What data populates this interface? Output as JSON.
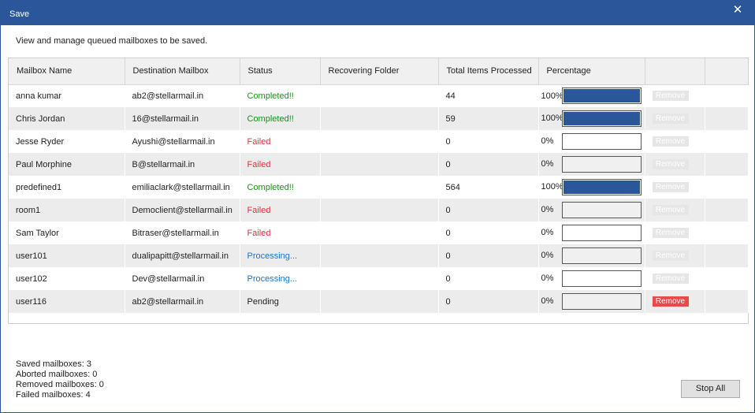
{
  "window": {
    "title": "Save",
    "close_glyph": "✕"
  },
  "description": "View and manage queued mailboxes to be saved.",
  "table": {
    "headers": [
      "Mailbox Name",
      "Destination Mailbox",
      "Status",
      "Recovering Folder",
      "Total Items Processed",
      "Percentage",
      ""
    ],
    "rows": [
      {
        "name": "anna kumar",
        "dest": "ab2@stellarmail.in",
        "status": "Completed!!",
        "status_kind": "completed",
        "folder": "",
        "items": "44",
        "pct": "100%",
        "fill": 1.0,
        "remove": "Remove",
        "remove_enabled": false
      },
      {
        "name": "Chris Jordan",
        "dest": "16@stellarmail.in",
        "status": "Completed!!",
        "status_kind": "completed",
        "folder": "",
        "items": "59",
        "pct": "100%",
        "fill": 1.0,
        "remove": "Remove",
        "remove_enabled": false
      },
      {
        "name": "Jesse Ryder",
        "dest": "Ayushi@stellarmail.in",
        "status": "Failed",
        "status_kind": "failed",
        "folder": "",
        "items": "0",
        "pct": "0%",
        "fill": 0,
        "remove": "Remove",
        "remove_enabled": false
      },
      {
        "name": "Paul Morphine",
        "dest": "B@stellarmail.in",
        "status": "Failed",
        "status_kind": "failed",
        "folder": "",
        "items": "0",
        "pct": "0%",
        "fill": 0,
        "remove": "Remove",
        "remove_enabled": false
      },
      {
        "name": "predefined1",
        "dest": "emiliaclark@stellarmail.in",
        "status": "Completed!!",
        "status_kind": "completed",
        "folder": "",
        "items": "564",
        "pct": "100%",
        "fill": 1.0,
        "remove": "Remove",
        "remove_enabled": false
      },
      {
        "name": "room1",
        "dest": "Democlient@stellarmail.in",
        "status": "Failed",
        "status_kind": "failed",
        "folder": "",
        "items": "0",
        "pct": "0%",
        "fill": 0,
        "remove": "Remove",
        "remove_enabled": false
      },
      {
        "name": "Sam Taylor",
        "dest": "Bitraser@stellarmail.in",
        "status": "Failed",
        "status_kind": "failed",
        "folder": "",
        "items": "0",
        "pct": "0%",
        "fill": 0,
        "remove": "Remove",
        "remove_enabled": false
      },
      {
        "name": "user101",
        "dest": "dualipapitt@stellarmail.in",
        "status": "Processing...",
        "status_kind": "processing",
        "folder": "",
        "items": "0",
        "pct": "0%",
        "fill": 0,
        "remove": "Remove",
        "remove_enabled": false
      },
      {
        "name": "user102",
        "dest": "Dev@stellarmail.in",
        "status": "Processing...",
        "status_kind": "processing",
        "folder": "",
        "items": "0",
        "pct": "0%",
        "fill": 0,
        "remove": "Remove",
        "remove_enabled": false
      },
      {
        "name": "user116",
        "dest": "ab2@stellarmail.in",
        "status": "Pending",
        "status_kind": "pending",
        "folder": "",
        "items": "0",
        "pct": "0%",
        "fill": 0,
        "remove": "Remove",
        "remove_enabled": true
      }
    ]
  },
  "stats": [
    "Saved mailboxes: 3",
    "Aborted mailboxes: 0",
    "Removed mailboxes: 0",
    "Failed mailboxes: 4"
  ],
  "buttons": {
    "stop_all": "Stop All"
  },
  "colors": {
    "accent": "#2b579a",
    "completed": "#1a8f1a",
    "failed": "#e0333a",
    "processing": "#1a73c8",
    "remove_active": "#e84a4a"
  }
}
